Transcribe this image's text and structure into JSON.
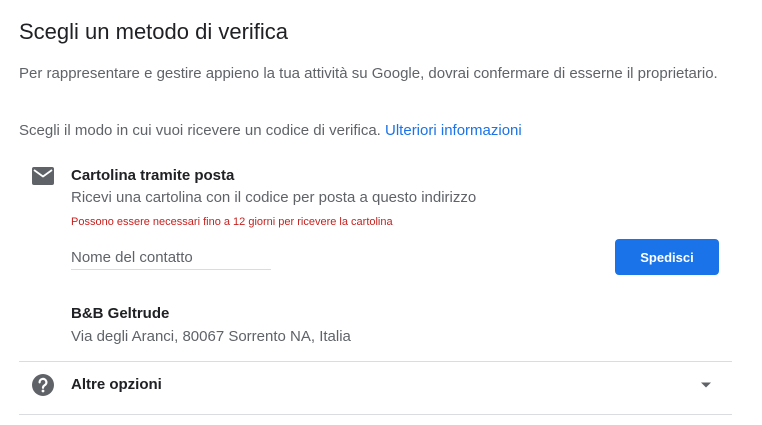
{
  "title": "Scegli un metodo di verifica",
  "intro": "Per rappresentare e gestire appieno la tua attività su Google, dovrai confermare di esserne il proprietario.",
  "choose": {
    "text": "Scegli il modo in cui vuoi ricevere un codice di verifica.",
    "link": "Ulteriori informazioni"
  },
  "postcard": {
    "icon": "mail-icon",
    "title": "Cartolina tramite posta",
    "description": "Ricevi una cartolina con il codice per posta a questo indirizzo",
    "warning": "Possono essere necessari fino a 12 giorni per ricevere la cartolina",
    "contact_placeholder": "Nome del contatto",
    "send_label": "Spedisci"
  },
  "business": {
    "name": "B&B Geltrude",
    "address": "Via degli Aranci, 80067 Sorrento NA, Italia"
  },
  "more_options": {
    "icon": "help-icon",
    "label": "Altre opzioni",
    "chevron": "chevron-down-icon"
  },
  "colors": {
    "accent": "#1a73e8",
    "warning": "#c5221f",
    "text_primary": "#202124",
    "text_secondary": "#5f6368",
    "divider": "#dadce0"
  }
}
